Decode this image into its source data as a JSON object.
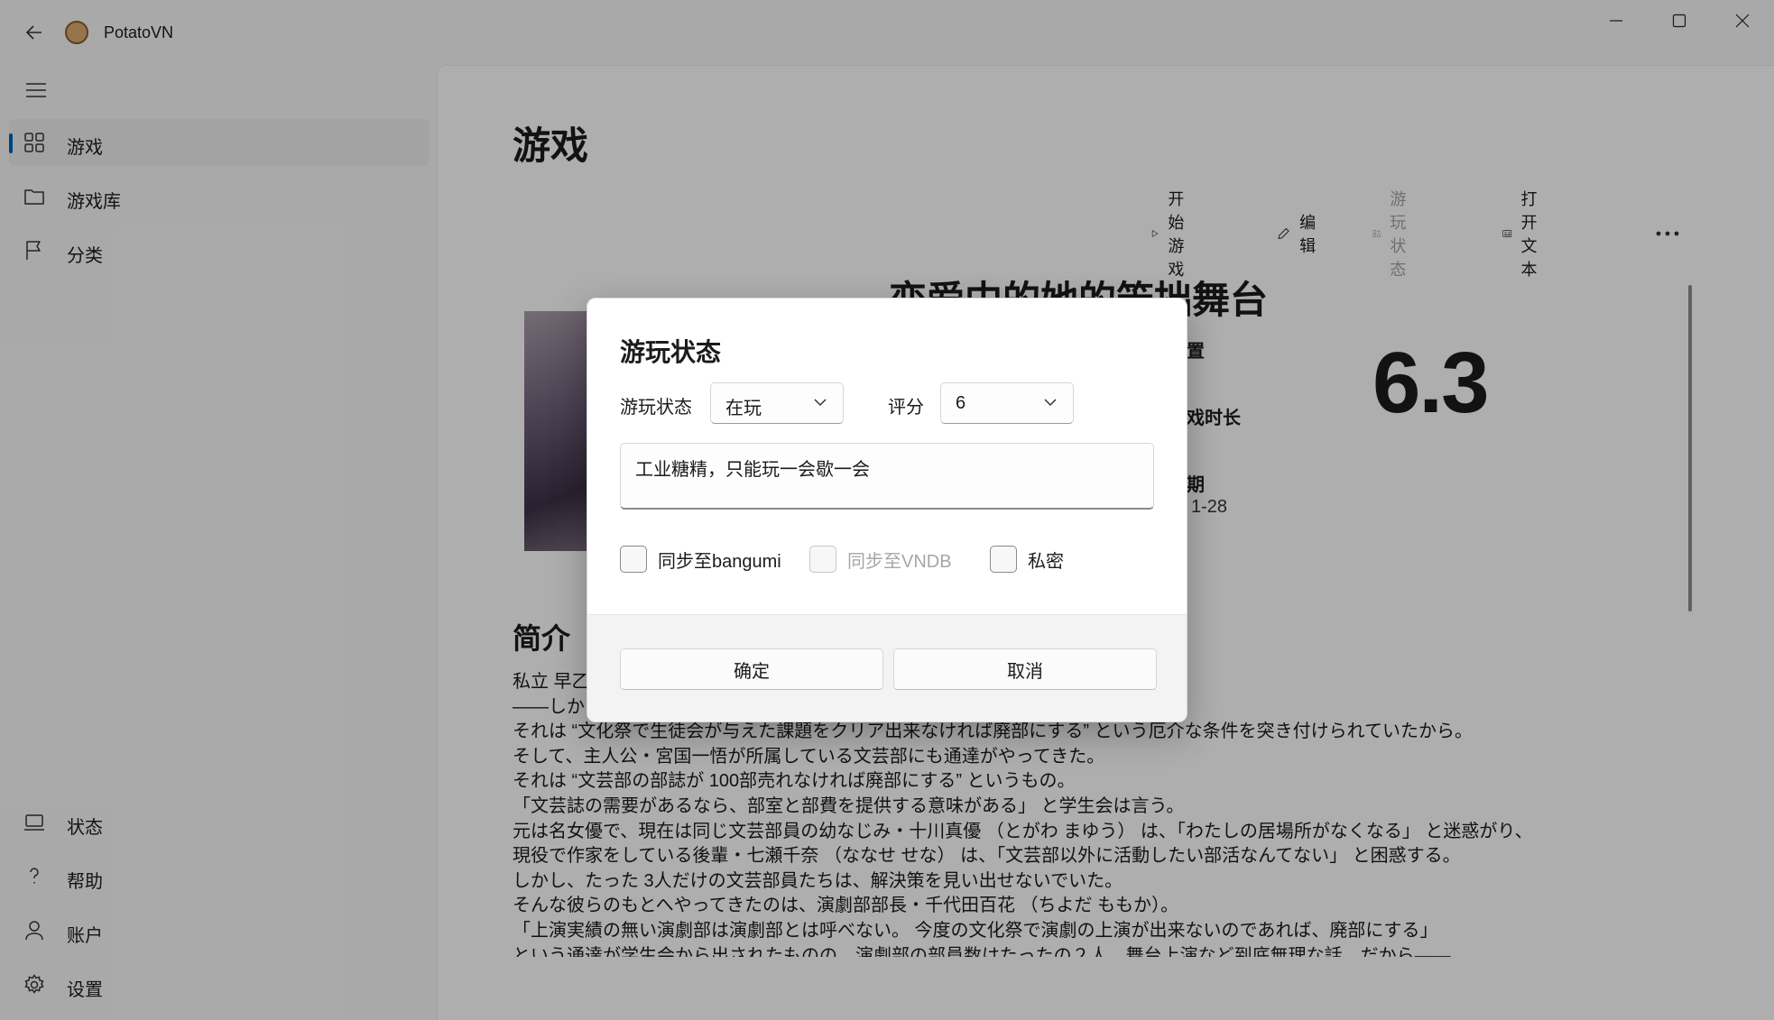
{
  "app": {
    "title": "PotatoVN"
  },
  "sidebar": {
    "items": [
      {
        "label": "游戏"
      },
      {
        "label": "游戏库"
      },
      {
        "label": "分类"
      }
    ],
    "footer_items": [
      {
        "label": "状态"
      },
      {
        "label": "帮助"
      },
      {
        "label": "账户"
      },
      {
        "label": "设置"
      }
    ]
  },
  "main": {
    "page_title": "游戏",
    "toolbar": {
      "start": "开始游戏",
      "edit": "编辑",
      "play_status": "游玩状态",
      "open_text": "打开文本"
    },
    "game_title": "恋爱中的她的笨拙舞台",
    "info": {
      "label1": "置",
      "label2": "戏时长",
      "label3": "期",
      "date_fragment": "1-28"
    },
    "rating": "6.3",
    "intro_title": "简介",
    "intro_lines": [
      "私立 早乙                                                                                                               大いに賑わっていた。",
      "——しか",
      "それは “文化祭で生徒会が与えた課題をクリア出来なければ廃部にする” という厄介な条件を突き付けられていたから。",
      "そして、主人公・宮国一悟が所属している文芸部にも通達がやってきた。",
      "それは “文芸部の部誌が 100部売れなければ廃部にする” というもの。",
      "「文芸誌の需要があるなら、部室と部費を提供する意味がある」 と学生会は言う。",
      "元は名女優で、現在は同じ文芸部員の幼なじみ・十川真優 （とがわ まゆう） は、「わたしの居場所がなくなる」 と迷惑がり、",
      "現役で作家をしている後輩・七瀬千奈 （ななせ せな） は、「文芸部以外に活動したい部活なんてない」 と困惑する。",
      "しかし、たった 3人だけの文芸部員たちは、解決策を見い出せないでいた。",
      "そんな彼らのもとへやってきたのは、演劇部部長・千代田百花 （ちよだ ももか）。",
      "「上演実績の無い演劇部は演劇部とは呼べない。 今度の文化祭で演劇の上演が出来ないのであれば、廃部にする」",
      "という通達が学生会から出されたものの、演劇部の部員数はたったの２人。舞台上演など到底無理な話。だから——"
    ]
  },
  "dialog": {
    "title": "游玩状态",
    "status_label": "游玩状态",
    "status_value": "在玩",
    "score_label": "评分",
    "score_value": "6",
    "comment": "工业糖精，只能玩一会歇一会",
    "sync_bangumi": "同步至bangumi",
    "sync_vndb": "同步至VNDB",
    "private": "私密",
    "confirm": "确定",
    "cancel": "取消"
  }
}
